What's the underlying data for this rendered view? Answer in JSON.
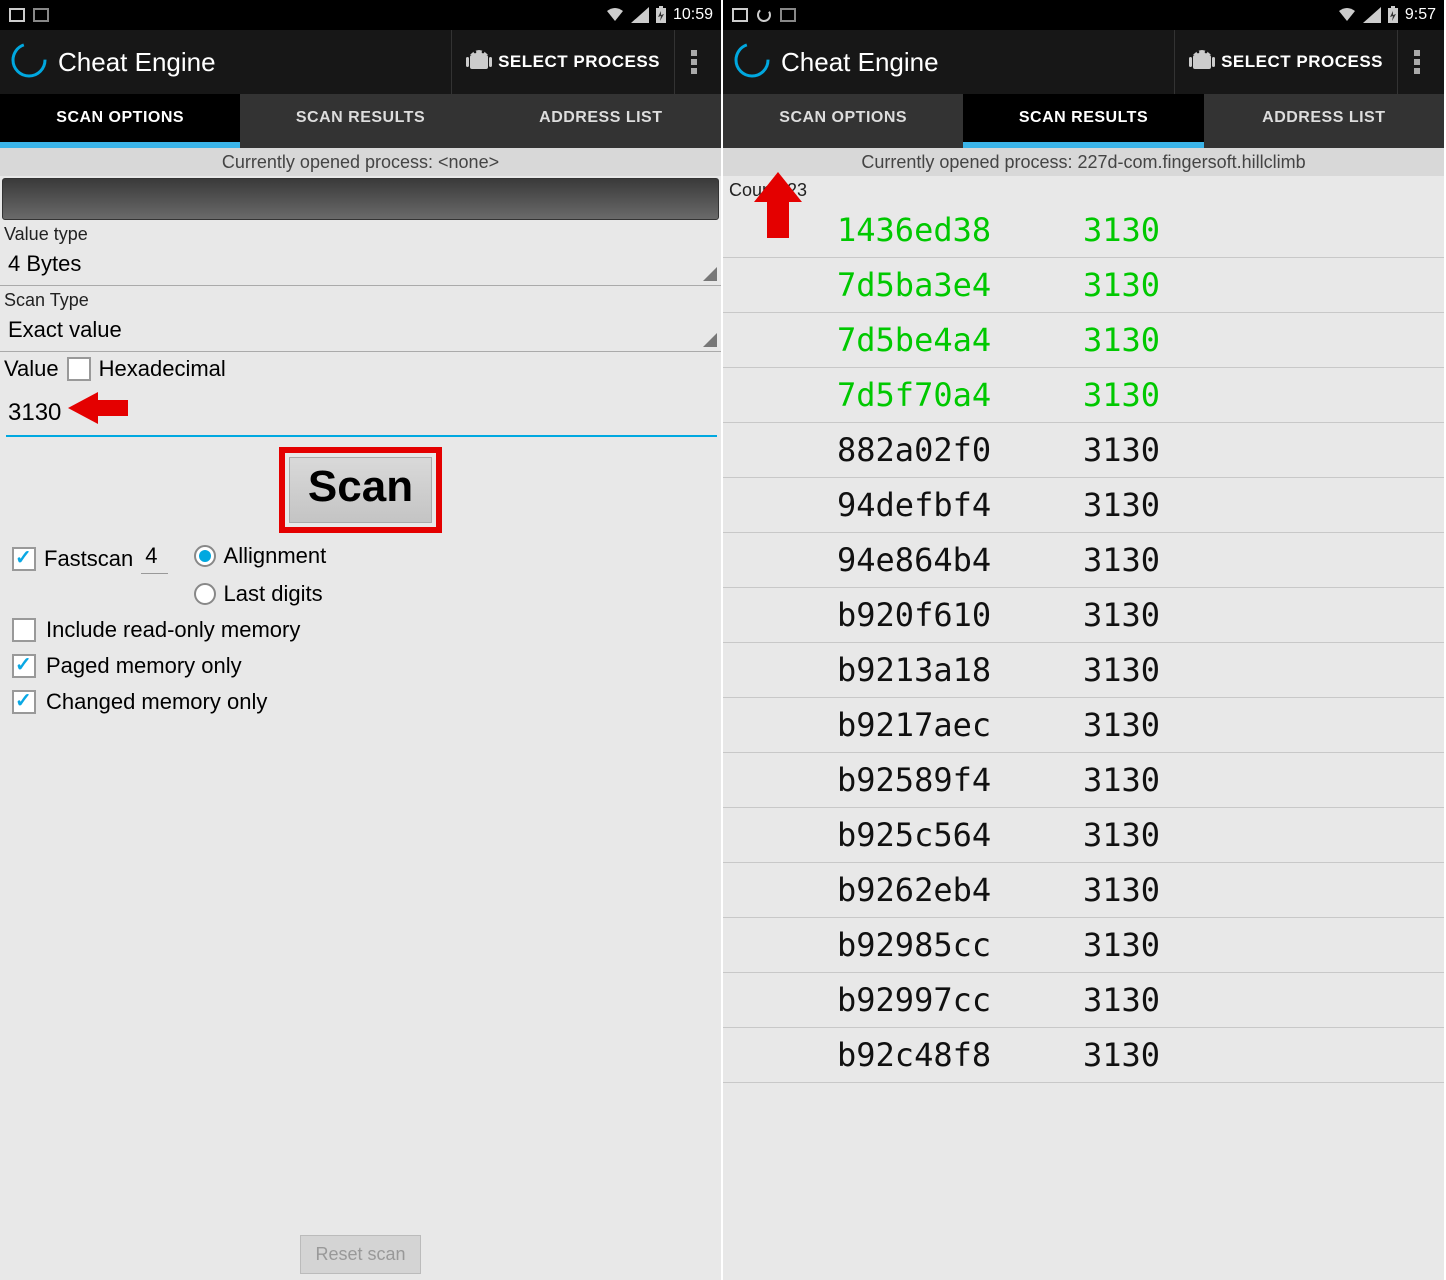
{
  "left": {
    "statusbar": {
      "time": "10:59"
    },
    "titlebar": {
      "title": "Cheat Engine",
      "select_process": "SELECT PROCESS"
    },
    "tabs": [
      "SCAN OPTIONS",
      "SCAN RESULTS",
      "ADDRESS LIST"
    ],
    "active_tab_index": 0,
    "process_line": "Currently opened process: <none>",
    "labels": {
      "value_type": "Value type",
      "scan_type": "Scan Type",
      "value": "Value",
      "hexadecimal": "Hexadecimal"
    },
    "value_type": "4 Bytes",
    "scan_type": "Exact value",
    "value_input": "3130",
    "scan_button": "Scan",
    "fastscan": {
      "label": "Fastscan",
      "checked": true,
      "num": "4"
    },
    "alignment": {
      "options": [
        "Allignment",
        "Last digits"
      ],
      "selected_index": 0
    },
    "checks": {
      "read_only": {
        "label": "Include read-only memory",
        "checked": false
      },
      "paged": {
        "label": "Paged memory only",
        "checked": true
      },
      "changed": {
        "label": "Changed memory only",
        "checked": true
      }
    },
    "reset": "Reset scan"
  },
  "right": {
    "statusbar": {
      "time": "9:57"
    },
    "titlebar": {
      "title": "Cheat Engine",
      "select_process": "SELECT PROCESS"
    },
    "tabs": [
      "SCAN OPTIONS",
      "SCAN RESULTS",
      "ADDRESS LIST"
    ],
    "active_tab_index": 1,
    "process_line": "Currently opened process: 227d-com.fingersoft.hillclimb",
    "count_label": "Count: 23",
    "results": [
      {
        "addr": "1436ed38",
        "val": "3130",
        "green": true
      },
      {
        "addr": "7d5ba3e4",
        "val": "3130",
        "green": true
      },
      {
        "addr": "7d5be4a4",
        "val": "3130",
        "green": true
      },
      {
        "addr": "7d5f70a4",
        "val": "3130",
        "green": true
      },
      {
        "addr": "882a02f0",
        "val": "3130",
        "green": false
      },
      {
        "addr": "94defbf4",
        "val": "3130",
        "green": false
      },
      {
        "addr": "94e864b4",
        "val": "3130",
        "green": false
      },
      {
        "addr": "b920f610",
        "val": "3130",
        "green": false
      },
      {
        "addr": "b9213a18",
        "val": "3130",
        "green": false
      },
      {
        "addr": "b9217aec",
        "val": "3130",
        "green": false
      },
      {
        "addr": "b92589f4",
        "val": "3130",
        "green": false
      },
      {
        "addr": "b925c564",
        "val": "3130",
        "green": false
      },
      {
        "addr": "b9262eb4",
        "val": "3130",
        "green": false
      },
      {
        "addr": "b92985cc",
        "val": "3130",
        "green": false
      },
      {
        "addr": "b92997cc",
        "val": "3130",
        "green": false
      },
      {
        "addr": "b92c48f8",
        "val": "3130",
        "green": false
      }
    ]
  }
}
